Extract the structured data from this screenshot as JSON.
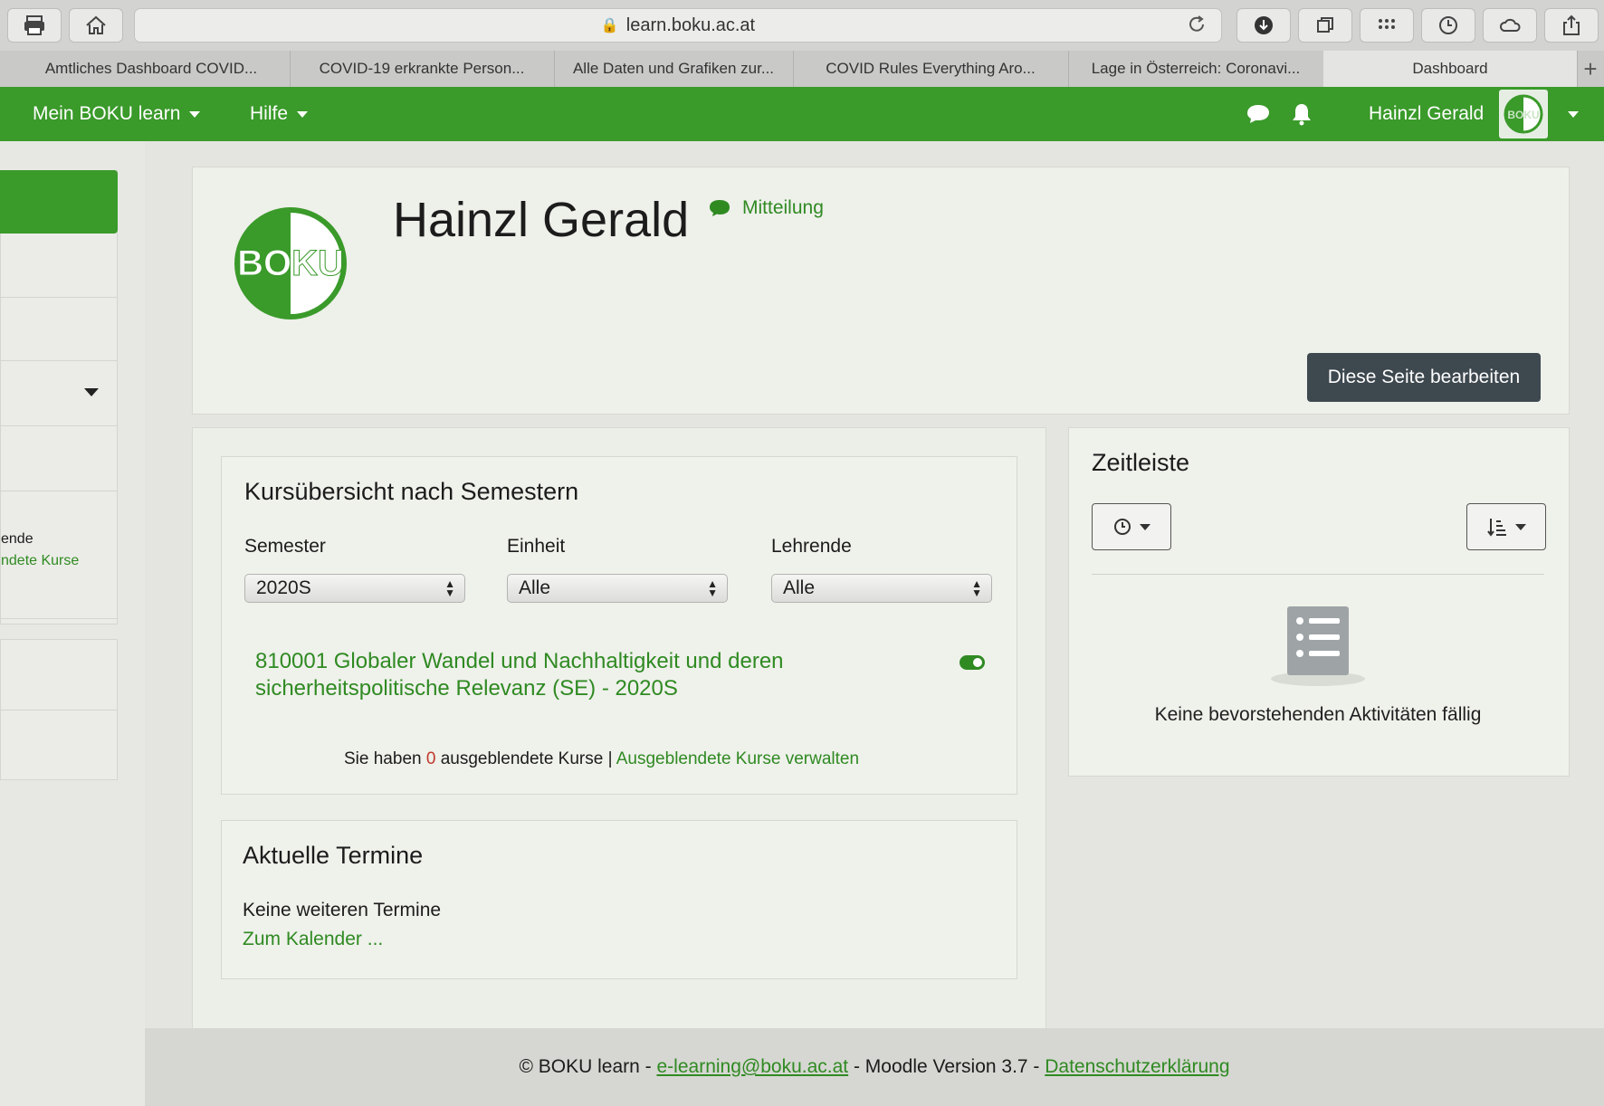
{
  "browser": {
    "url": "learn.boku.ac.at",
    "tabs": [
      {
        "label": "Amtliches Dashboard COVID..."
      },
      {
        "label": "COVID-19 erkrankte Person..."
      },
      {
        "label": "Alle Daten und Grafiken zur..."
      },
      {
        "label": "COVID Rules Everything Aro..."
      },
      {
        "label": "Lage in Österreich: Coronavi..."
      },
      {
        "label": "Dashboard"
      }
    ]
  },
  "navbar": {
    "menu_label": "Mein BOKU learn",
    "help_label": "Hilfe",
    "user_name": "Hainzl Gerald",
    "avatar_text": "BOKU"
  },
  "sidebar": {
    "text_fragment": "ende",
    "link_fragment": "ndete Kurse"
  },
  "profile": {
    "name": "Hainzl Gerald",
    "message_label": "Mitteilung",
    "edit_button": "Diese Seite bearbeiten",
    "logo_text": "BOKU"
  },
  "course_overview": {
    "title": "Kursübersicht nach Semestern",
    "filters": [
      {
        "label": "Semester",
        "value": "2020S"
      },
      {
        "label": "Einheit",
        "value": "Alle"
      },
      {
        "label": "Lehrende",
        "value": "Alle"
      }
    ],
    "course_line1": "810001 Globaler Wandel und Nachhaltigkeit und deren",
    "course_line2": "sicherheitspolitische Relevanz (SE) - 2020S",
    "hidden_prefix": "Sie haben",
    "hidden_count": "0",
    "hidden_suffix": "ausgeblendete Kurse |",
    "hidden_link": "Ausgeblendete Kurse verwalten"
  },
  "events": {
    "title": "Aktuelle Termine",
    "empty_text": "Keine weiteren Termine",
    "calendar_link": "Zum Kalender ..."
  },
  "timeline": {
    "title": "Zeitleiste",
    "empty_text": "Keine bevorstehenden Aktivitäten fällig"
  },
  "footer": {
    "prefix": "© BOKU learn -",
    "email": "e-learning@boku.ac.at",
    "middle": "- Moodle Version 3.7 -",
    "privacy_link": "Datenschutzerklärung"
  },
  "colors": {
    "brand_green": "#3a9a2a",
    "link_green": "#2f8a22",
    "button_dark": "#3e484f"
  }
}
